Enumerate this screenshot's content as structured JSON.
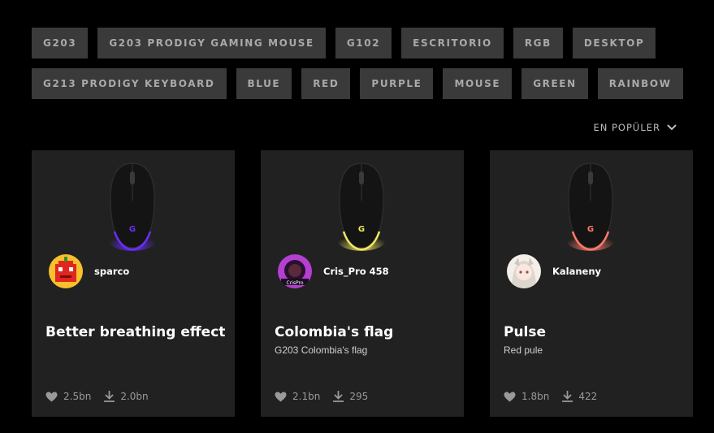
{
  "tags": {
    "row1": [
      "G203",
      "G203 PRODIGY GAMING MOUSE",
      "G102",
      "ESCRITORIO",
      "RGB",
      "DESKTOP"
    ],
    "row2": [
      "G213 PRODIGY KEYBOARD",
      "BLUE",
      "RED",
      "PURPLE",
      "MOUSE",
      "GREEN",
      "RAINBOW"
    ]
  },
  "sort": {
    "label": "EN POPÜLER"
  },
  "cards": [
    {
      "author": "sparco",
      "title": "Better breathing effect",
      "subtitle": "",
      "likes": "2.5bn",
      "downloads": "2.0bn",
      "glow": "#6a2cff"
    },
    {
      "author": "Cris_Pro 458",
      "title": "Colombia's flag",
      "subtitle": "G203 Colombia's flag",
      "likes": "2.1bn",
      "downloads": "295",
      "glow": "#f2e85c"
    },
    {
      "author": "Kalaneny",
      "title": "Pulse",
      "subtitle": "Red pule",
      "likes": "1.8bn",
      "downloads": "422",
      "glow": "#ff7a6a"
    }
  ],
  "icons": {
    "heart": "heart-icon",
    "download": "download-icon",
    "chevron": "chevron-down-icon"
  }
}
